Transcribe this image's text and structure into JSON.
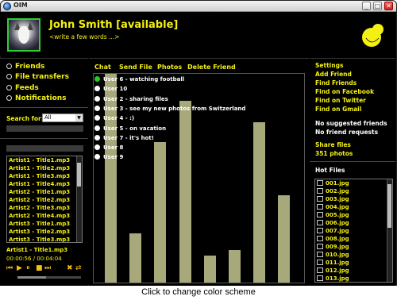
{
  "app": {
    "title": "OIM"
  },
  "window_buttons": {
    "minimize": "_",
    "maximize": "□",
    "close": "✕"
  },
  "profile": {
    "name": "John Smith [available]",
    "status_message": "<write a few words ...>"
  },
  "nav": [
    {
      "label": "Friends"
    },
    {
      "label": "File transfers"
    },
    {
      "label": "Feeds"
    },
    {
      "label": "Notifications"
    }
  ],
  "search": {
    "label": "Search for:",
    "selected": "All"
  },
  "playlist": [
    "Artist1 - Title1.mp3",
    "Artist1 - Title2.mp3",
    "Artist1 - Title3.mp3",
    "Artist1 - Title4.mp3",
    "Artist2 - Title1.mp3",
    "Artist2 - Title2.mp3",
    "Artist2 - Title3.mp3",
    "Artist2 - Title4.mp3",
    "Artist3 - Title1.mp3",
    "Artist3 - Title2.mp3",
    "Artist3 - Title3.mp3"
  ],
  "player": {
    "now_playing": "Artist1 - Title1.mp3",
    "time": "00:00:56 / 00:04:04",
    "volume_level": 0.45
  },
  "tabs": [
    {
      "label": "Chat"
    },
    {
      "label": "Send File"
    },
    {
      "label": "Photos"
    },
    {
      "label": "Delete Friend"
    }
  ],
  "friends": [
    {
      "label": "User 6 - watching football",
      "online": true
    },
    {
      "label": "User 10",
      "online": false
    },
    {
      "label": "User 2 - sharing files",
      "online": false
    },
    {
      "label": "User 3 - see my new photos from Switzerland",
      "online": false
    },
    {
      "label": "User 4 - :)",
      "online": false
    },
    {
      "label": "User 5 - on vacation",
      "online": false
    },
    {
      "label": "User 7 - it's hot!",
      "online": false
    },
    {
      "label": "User 8",
      "online": false
    },
    {
      "label": "User 9",
      "online": false
    }
  ],
  "right_links": [
    {
      "label": "Settings"
    },
    {
      "label": "Add Friend"
    },
    {
      "label": "Find Friends"
    },
    {
      "label": "Find on Facebook"
    },
    {
      "label": "Find on Twitter"
    },
    {
      "label": "Find on Gmail"
    }
  ],
  "right_info": {
    "suggested": "No suggested friends",
    "requests": "No friend requests"
  },
  "shares": {
    "files_label": "Share files",
    "photos_label": "351 photos"
  },
  "hot_files": {
    "title": "Hot Files",
    "items": [
      "001.jpg",
      "002.jpg",
      "003.jpg",
      "004.jpg",
      "005.jpg",
      "006.jpg",
      "007.jpg",
      "008.jpg",
      "009.jpg",
      "010.jpg",
      "011.jpg",
      "012.jpg",
      "013.jpg"
    ]
  },
  "footer": {
    "text": "Click to change color scheme"
  },
  "colors": {
    "accent": "#f4f013",
    "background": "#000000",
    "bar": "#a7a97a",
    "online": "#22cc22"
  }
}
